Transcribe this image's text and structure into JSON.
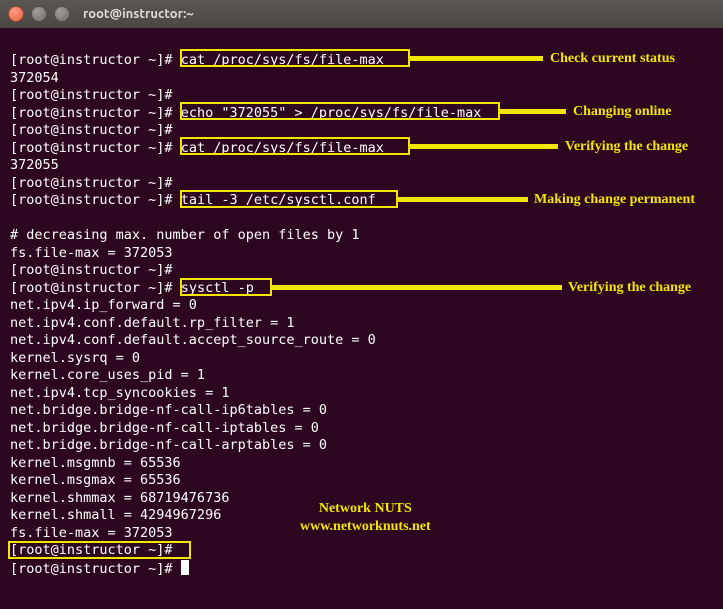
{
  "window": {
    "title": "root@instructor:~"
  },
  "prompts": {
    "p": "[root@instructor ~]#"
  },
  "lines": {
    "l1_cmd": "cat /proc/sys/fs/file-max",
    "l1_out": "372054",
    "l2_blank": "",
    "l3_cmd": "echo \"372055\" > /proc/sys/fs/file-max",
    "l4_blank": "",
    "l5_cmd": "cat /proc/sys/fs/file-max",
    "l5_out": "372055",
    "l6_blank": "",
    "l7_cmd": "tail -3 /etc/sysctl.conf",
    "l8_blank_after": "",
    "l9_note": "# decreasing max. number of open files by 1",
    "l10_val": "fs.file-max = 372053",
    "l11_blank": "",
    "l12_cmd": "sysctl -p",
    "o1": "net.ipv4.ip_forward = 0",
    "o2": "net.ipv4.conf.default.rp_filter = 1",
    "o3": "net.ipv4.conf.default.accept_source_route = 0",
    "o4": "kernel.sysrq = 0",
    "o5": "kernel.core_uses_pid = 1",
    "o6": "net.ipv4.tcp_syncookies = 1",
    "o7": "net.bridge.bridge-nf-call-ip6tables = 0",
    "o8": "net.bridge.bridge-nf-call-iptables = 0",
    "o9": "net.bridge.bridge-nf-call-arptables = 0",
    "o10": "kernel.msgmnb = 65536",
    "o11": "kernel.msgmax = 65536",
    "o12": "kernel.shmmax = 68719476736",
    "o13": "kernel.shmall = 4294967296",
    "o14": "fs.file-max = 372053",
    "final_blank": ""
  },
  "annotations": {
    "a1": "Check current status",
    "a2": "Changing online",
    "a3": "Verifying the change",
    "a4": "Making change permanent",
    "a5": "Verifying the change"
  },
  "watermark": {
    "line1": "Network NUTS",
    "line2": "www.networknuts.net"
  }
}
